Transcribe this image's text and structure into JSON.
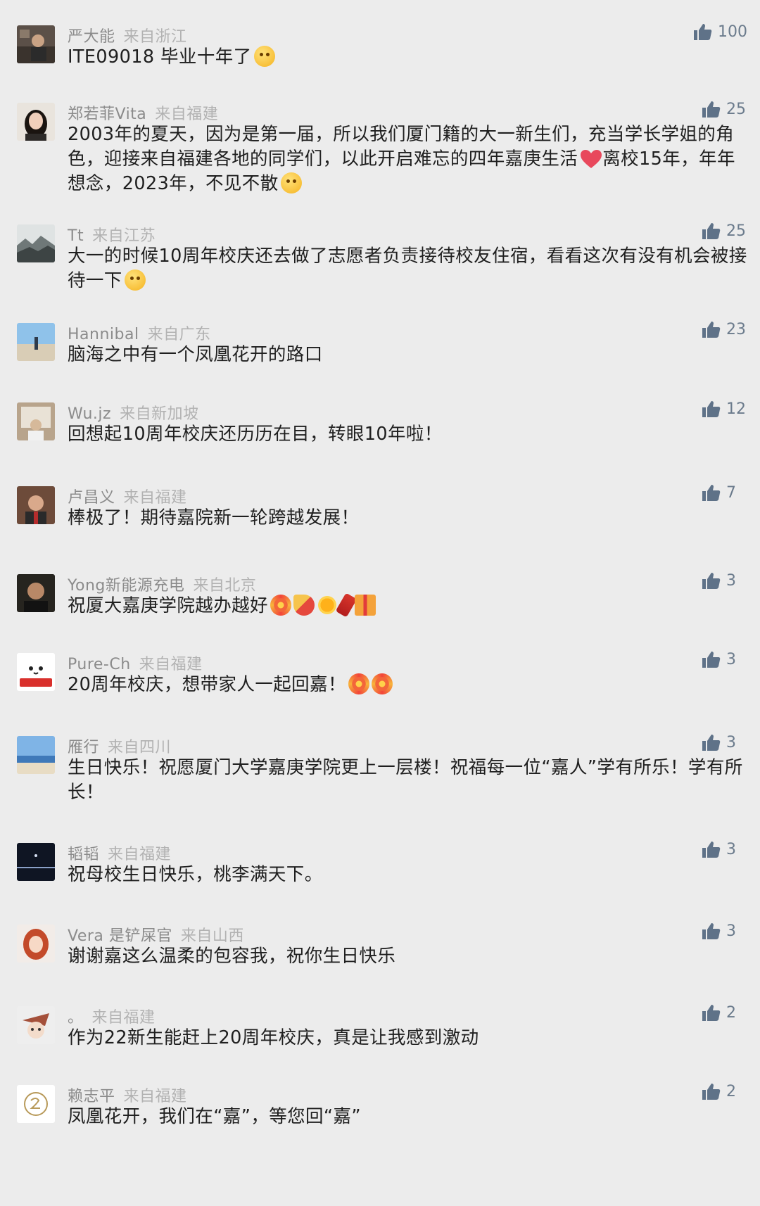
{
  "comments": [
    {
      "nick": "严大能",
      "loc": "来自浙江",
      "text": "ITE09018 毕业十年了",
      "likes": "100",
      "emojis": [
        "face"
      ]
    },
    {
      "nick": "郑若菲Vita",
      "loc": "来自福建",
      "text": "2003年的夏天，因为是第一届，所以我们厦门籍的大一新生们，充当学长学姐的角色，迎接来自福建各地的同学们，以此开启难忘的四年嘉庚生活",
      "text2": "离校15年，年年想念，2023年，不见不散",
      "likes": "25",
      "emojis": [
        "face"
      ]
    },
    {
      "nick": "Tt",
      "loc": "来自江苏",
      "text": "大一的时候10周年校庆还去做了志愿者负责接待校友住宿，看看这次有没有机会被接待一下",
      "likes": "25",
      "emojis": [
        "face"
      ]
    },
    {
      "nick": "Hannibal",
      "loc": "来自广东",
      "text": "脑海之中有一个凤凰花开的路口",
      "likes": "23",
      "emojis": []
    },
    {
      "nick": "Wu.jz",
      "loc": "来自新加坡",
      "text": "回想起10周年校庆还历历在目，转眼10年啦！",
      "likes": "12",
      "emojis": []
    },
    {
      "nick": "卢昌义",
      "loc": "来自福建",
      "text": "棒极了！期待嘉院新一轮跨越发展！",
      "likes": "7",
      "emojis": []
    },
    {
      "nick": "Yong新能源充电",
      "loc": "来自北京",
      "text": "祝厦大嘉庚学院越办越好",
      "likes": "3",
      "emojis": [
        "firework",
        "party",
        "sun",
        "firecracker",
        "gift"
      ]
    },
    {
      "nick": "Pure-Ch",
      "loc": "来自福建",
      "text": "20周年校庆，想带家人一起回嘉！",
      "likes": "3",
      "emojis": [
        "firework",
        "firework"
      ]
    },
    {
      "nick": "雁行",
      "loc": "来自四川",
      "text": "生日快乐！祝愿厦门大学嘉庚学院更上一层楼！祝福每一位“嘉人”学有所乐！学有所长！",
      "likes": "3",
      "emojis": []
    },
    {
      "nick": "韬韬",
      "loc": "来自福建",
      "text": "祝母校生日快乐，桃李满天下。",
      "likes": "3",
      "emojis": []
    },
    {
      "nick": "Vera 是铲屎官",
      "loc": "来自山西",
      "text": "谢谢嘉这么温柔的包容我，祝你生日快乐",
      "likes": "3",
      "emojis": []
    },
    {
      "nick": "。",
      "loc": "来自福建",
      "text": "作为22新生能赶上20周年校庆，真是让我感到激动",
      "likes": "2",
      "emojis": []
    },
    {
      "nick": "赖志平",
      "loc": "来自福建",
      "text": "凤凰花开，我们在“嘉”，等您回“嘉”",
      "likes": "2",
      "emojis": []
    }
  ]
}
